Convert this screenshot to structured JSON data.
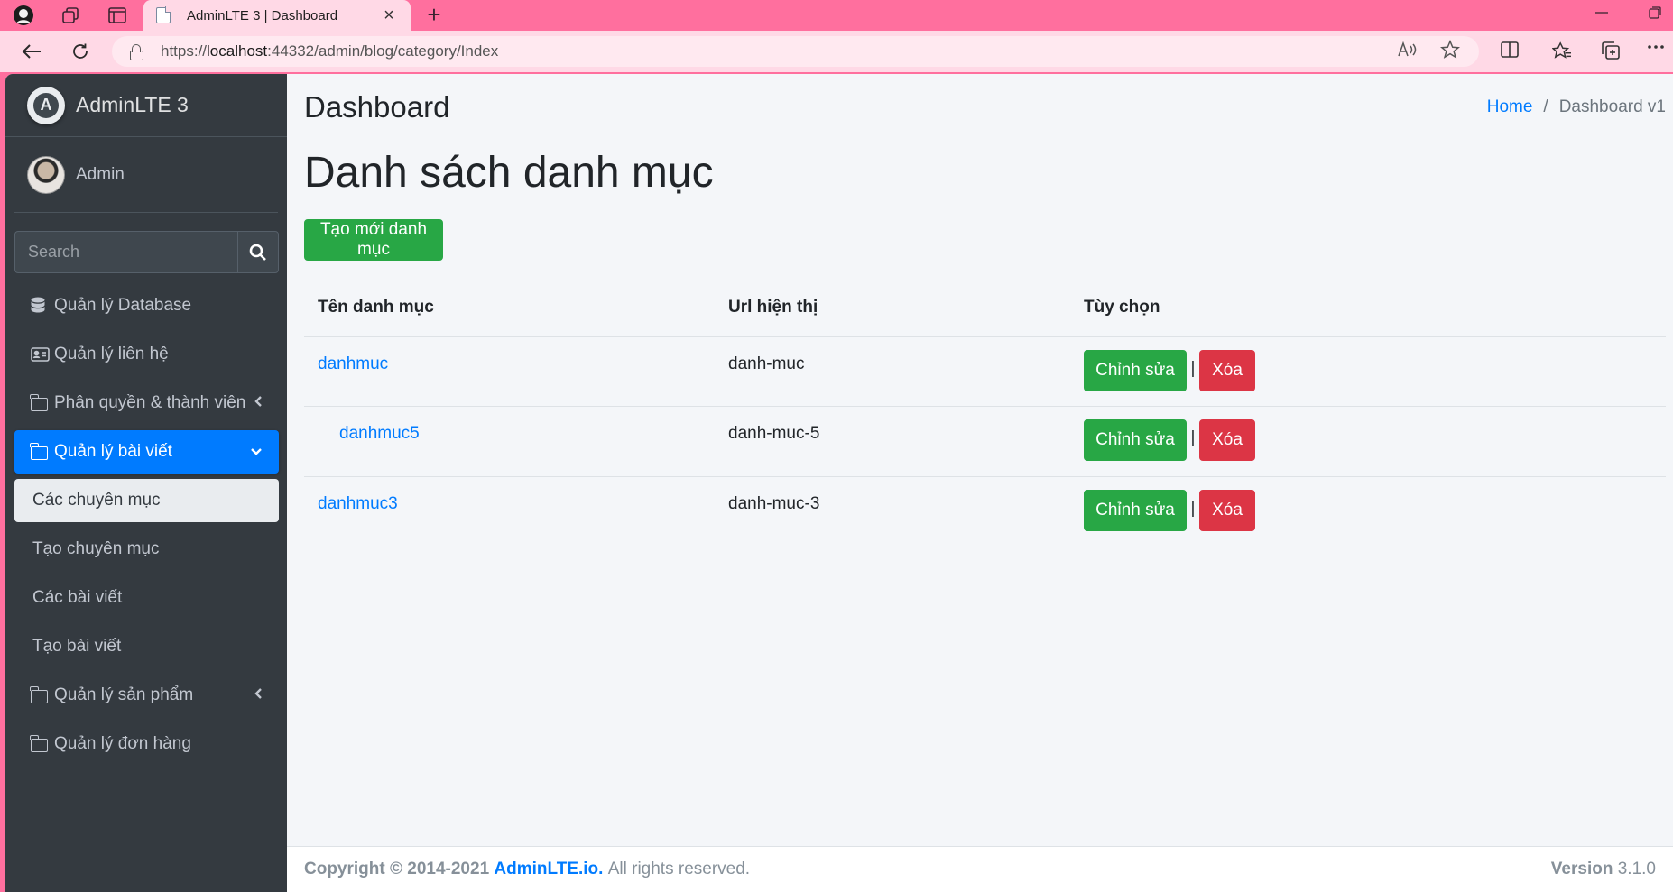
{
  "browser": {
    "tab_title": "AdminLTE 3 | Dashboard",
    "tab_close": "×",
    "new_tab": "+",
    "url_scheme": "https://",
    "url_host": "localhost",
    "url_path": ":44332/admin/blog/category/Index"
  },
  "brand": {
    "name": "AdminLTE 3",
    "logo_letter": "A"
  },
  "user": {
    "name": "Admin"
  },
  "search": {
    "placeholder": "Search"
  },
  "sidebar": {
    "items": [
      {
        "label": "Quản lý Database"
      },
      {
        "label": "Quản lý liên hệ"
      },
      {
        "label": "Phân quyền & thành viên"
      },
      {
        "label": "Quản lý bài viết"
      },
      {
        "label": "Các chuyên mục"
      },
      {
        "label": "Tạo chuyên mục"
      },
      {
        "label": "Các bài viết"
      },
      {
        "label": "Tạo bài viết"
      },
      {
        "label": "Quản lý sản phẩm"
      },
      {
        "label": "Quản lý đơn hàng"
      }
    ]
  },
  "header": {
    "title": "Dashboard",
    "breadcrumb_home": "Home",
    "breadcrumb_sep": "/",
    "breadcrumb_current": "Dashboard v1"
  },
  "main": {
    "heading": "Danh sách danh mục",
    "create_button": "Tạo mới danh mục",
    "columns": [
      "Tên danh mục",
      "Url hiện thị",
      "Tùy chọn"
    ],
    "rows": [
      {
        "name": "danhmuc",
        "url": "danh-muc",
        "edit": "Chỉnh sửa",
        "delete": "Xóa"
      },
      {
        "name": "danhmuc5",
        "url": "danh-muc-5",
        "edit": "Chỉnh sửa",
        "delete": "Xóa"
      },
      {
        "name": "danhmuc3",
        "url": "danh-muc-3",
        "edit": "Chỉnh sửa",
        "delete": "Xóa"
      }
    ],
    "separator": "|"
  },
  "footer": {
    "copyright": "Copyright © 2014-2021",
    "link": "AdminLTE.io.",
    "rights": "All rights reserved.",
    "version_label": "Version",
    "version": "3.1.0"
  },
  "colors": {
    "browser_frame": "#ff6f9e",
    "sidebar_bg": "#343a40",
    "active": "#007bff",
    "success": "#28a745",
    "danger": "#dc3545"
  }
}
